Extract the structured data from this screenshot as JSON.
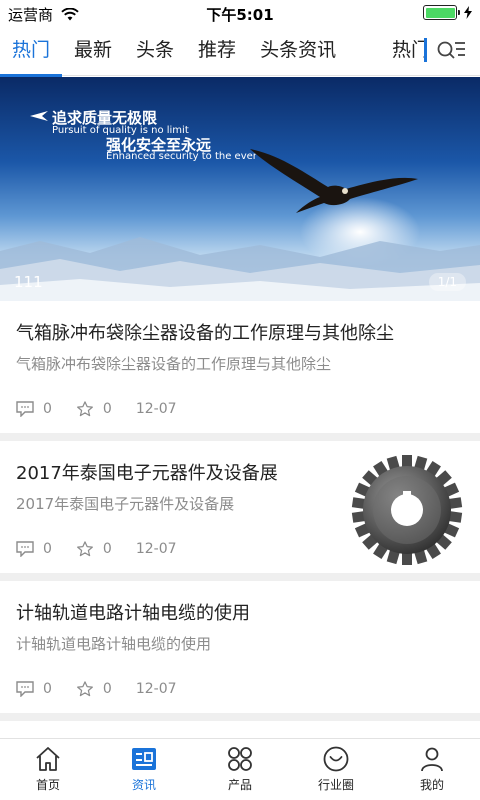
{
  "status_bar": {
    "carrier": "运营商",
    "time": "下午5:01",
    "battery_level": 1.0
  },
  "tabs": [
    {
      "label": "热门",
      "active": true
    },
    {
      "label": "最新"
    },
    {
      "label": "头条"
    },
    {
      "label": "推荐"
    },
    {
      "label": "头条资讯"
    },
    {
      "label": "热门"
    }
  ],
  "banner": {
    "line1": "追求质量无极限",
    "line1_sub": "Pursuit of quality is no limit",
    "line2": "强化安全至永远",
    "line2_sub": "Enhanced security to the ever",
    "caption": "111",
    "pager": "1/1"
  },
  "news": [
    {
      "title": "气箱脉冲布袋除尘器设备的工作原理与其他除尘",
      "desc": "气箱脉冲布袋除尘器设备的工作原理与其他除尘",
      "comments": "0",
      "likes": "0",
      "date": "12-07",
      "has_image": false
    },
    {
      "title": "2017年泰国电子元器件及设备展",
      "desc": "2017年泰国电子元器件及设备展",
      "comments": "0",
      "likes": "0",
      "date": "12-07",
      "has_image": true,
      "image_icon": "gear-image"
    },
    {
      "title": "计轴轨道电路计轴电缆的使用",
      "desc": "计轴轨道电路计轴电缆的使用",
      "comments": "0",
      "likes": "0",
      "date": "12-07",
      "has_image": false
    }
  ],
  "bottom_nav": [
    {
      "label": "首页",
      "icon": "home-icon"
    },
    {
      "label": "资讯",
      "icon": "news-icon",
      "active": true
    },
    {
      "label": "产品",
      "icon": "grid-icon"
    },
    {
      "label": "行业圈",
      "icon": "smile-icon"
    },
    {
      "label": "我的",
      "icon": "user-icon"
    }
  ],
  "colors": {
    "accent": "#1a73d9",
    "text": "#222222",
    "muted": "#8c8c8c",
    "divider": "#efefef"
  }
}
